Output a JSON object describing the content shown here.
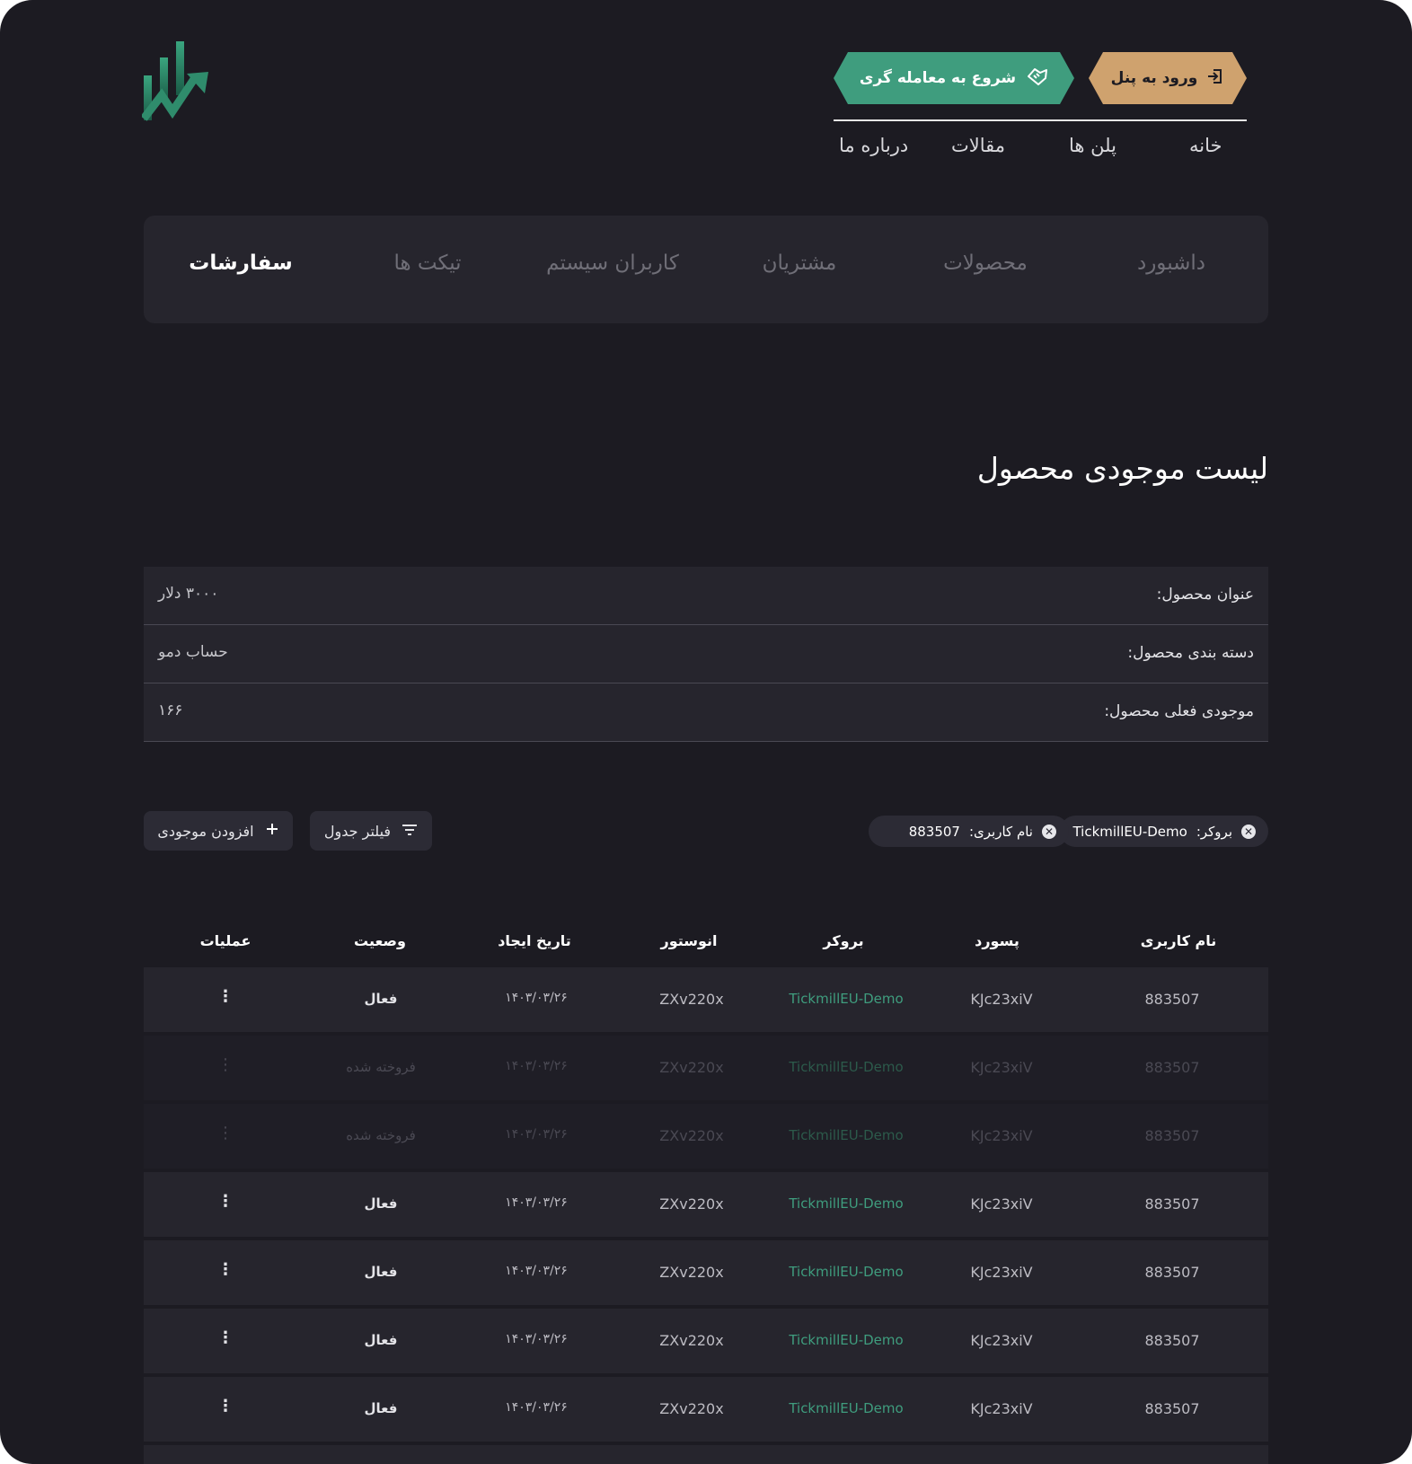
{
  "header": {
    "login_button": "ورود به پنل",
    "trade_button": "شروع به معامله گری",
    "nav": [
      "خانه",
      "پلن ها",
      "مقالات",
      "درباره ما"
    ]
  },
  "tabs": [
    "داشبورد",
    "محصولات",
    "مشتریان",
    "کاربران سیستم",
    "تیکت ها",
    "سفارشات"
  ],
  "active_tab": "سفارشات",
  "page_title": "لیست موجودی محصول",
  "product_info": [
    {
      "label": "عنوان محصول:",
      "value": "۳۰۰۰ دلار"
    },
    {
      "label": "دسته بندی محصول:",
      "value": "حساب دمو"
    },
    {
      "label": "موجودی فعلی محصول:",
      "value": "۱۶۶"
    }
  ],
  "filters": {
    "chips": [
      {
        "label": "بروکر:",
        "value": "TickmillEU-Demo"
      },
      {
        "label": "نام کاربری:",
        "value": "883507"
      }
    ],
    "filter_button": "فیلتر جدول",
    "add_button": "افزودن موجودی"
  },
  "table": {
    "columns": [
      "نام کاربری",
      "پسورد",
      "بروکر",
      "انوستور",
      "تاریخ ایجاد",
      "وصعیت",
      "عملیات"
    ],
    "rows": [
      {
        "username": "883507",
        "password": "KJc23xiV",
        "broker": "TickmillEU-Demo",
        "investor": "ZXv220x",
        "date": "۱۴۰۳/۰۳/۲۶",
        "status": "فعال",
        "ops": "⋮"
      },
      {
        "username": "883507",
        "password": "KJc23xiV",
        "broker": "TickmillEU-Demo",
        "investor": "ZXv220x",
        "date": "۱۴۰۳/۰۳/۲۶",
        "status": "فروخته شده",
        "ops": "⋮"
      },
      {
        "username": "883507",
        "password": "KJc23xiV",
        "broker": "TickmillEU-Demo",
        "investor": "ZXv220x",
        "date": "۱۴۰۳/۰۳/۲۶",
        "status": "فروخته شده",
        "ops": "⋮"
      },
      {
        "username": "883507",
        "password": "KJc23xiV",
        "broker": "TickmillEU-Demo",
        "investor": "ZXv220x",
        "date": "۱۴۰۳/۰۳/۲۶",
        "status": "فعال",
        "ops": "⋮"
      },
      {
        "username": "883507",
        "password": "KJc23xiV",
        "broker": "TickmillEU-Demo",
        "investor": "ZXv220x",
        "date": "۱۴۰۳/۰۳/۲۶",
        "status": "فعال",
        "ops": "⋮"
      },
      {
        "username": "883507",
        "password": "KJc23xiV",
        "broker": "TickmillEU-Demo",
        "investor": "ZXv220x",
        "date": "۱۴۰۳/۰۳/۲۶",
        "status": "فعال",
        "ops": "⋮"
      },
      {
        "username": "883507",
        "password": "KJc23xiV",
        "broker": "TickmillEU-Demo",
        "investor": "ZXv220x",
        "date": "۱۴۰۳/۰۳/۲۶",
        "status": "فعال",
        "ops": "⋮"
      }
    ]
  },
  "colors": {
    "background": "#1c1b22",
    "panel": "#26252d",
    "gold": "#cfa26e",
    "green": "#3f9d7e"
  },
  "icons": [
    "logo-chart-icon",
    "login-icon",
    "handshake-icon",
    "close-icon",
    "filter-icon",
    "plus-icon",
    "more-vertical-icon"
  ]
}
